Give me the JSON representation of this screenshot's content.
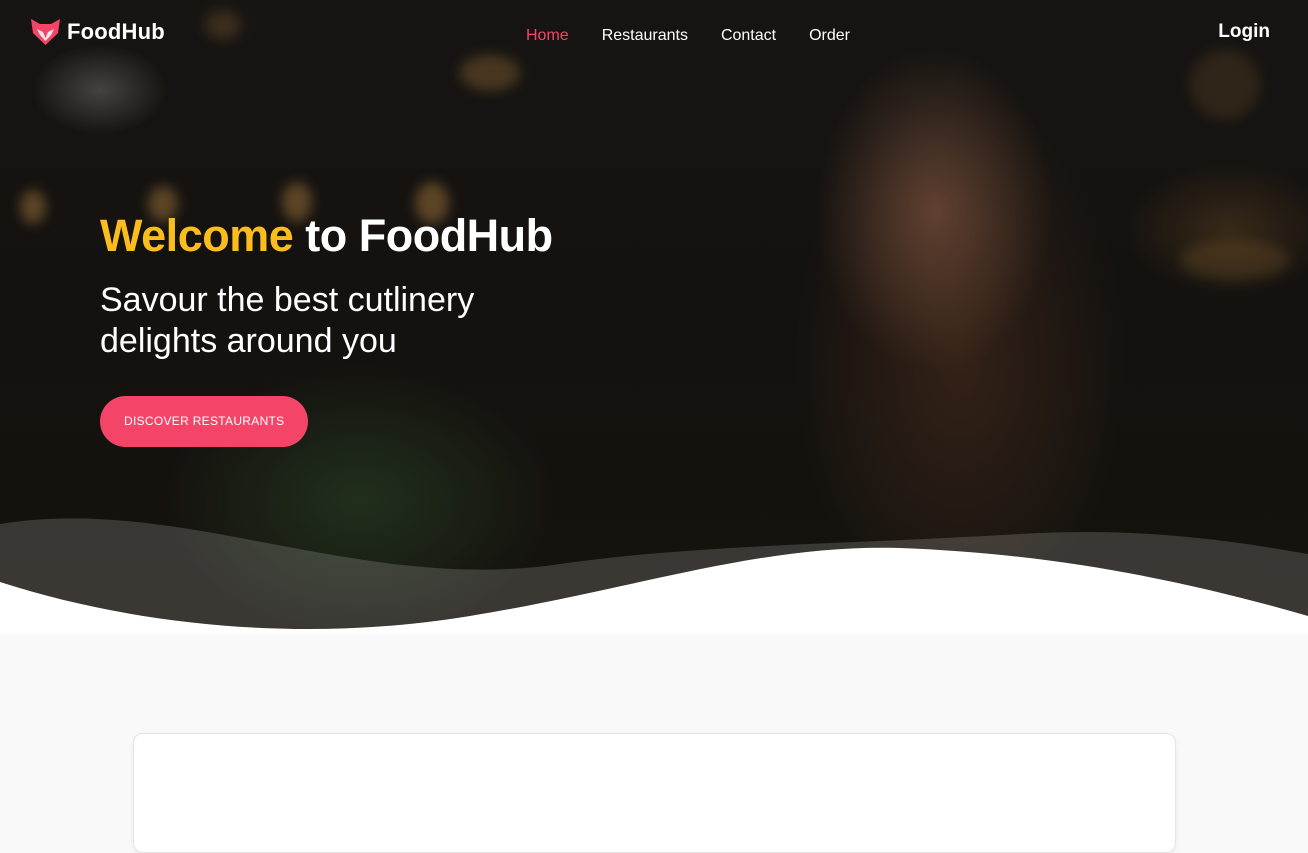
{
  "brand": {
    "name": "FoodHub",
    "logo_icon": "fox-logo-icon",
    "accent_color": "#f44467"
  },
  "nav": {
    "links": [
      {
        "label": "Home",
        "active": true
      },
      {
        "label": "Restaurants",
        "active": false
      },
      {
        "label": "Contact",
        "active": false
      },
      {
        "label": "Order",
        "active": false
      }
    ],
    "login_label": "Login"
  },
  "hero": {
    "title_highlight": "Welcome",
    "title_rest": " to FoodHub",
    "title_highlight_color": "#fbbd1e",
    "subtitle": "Savour the best cutlinery delights around you",
    "cta_label": "DISCOVER RESTAURANTS"
  }
}
